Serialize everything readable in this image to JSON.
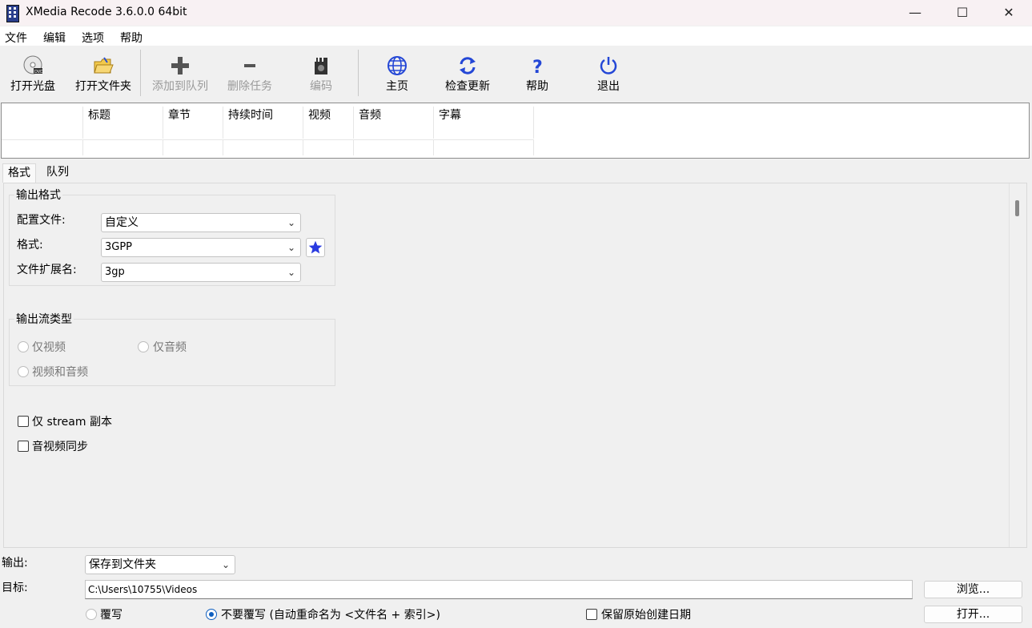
{
  "window": {
    "title": "XMedia Recode 3.6.0.0 64bit",
    "min": "—",
    "max": "☐",
    "close": "✕"
  },
  "menu": [
    "文件",
    "编辑",
    "选项",
    "帮助"
  ],
  "toolbar": {
    "open_disc": "打开光盘",
    "open_folder": "打开文件夹",
    "add_queue": "添加到队列",
    "delete_task": "删除任务",
    "encode": "编码",
    "home": "主页",
    "check_update": "检查更新",
    "help": "帮助",
    "exit": "退出"
  },
  "list": {
    "columns": [
      "标题",
      "章节",
      "持续时间",
      "视频",
      "音频",
      "字幕"
    ]
  },
  "tabs": [
    "格式",
    "队列"
  ],
  "output_format": {
    "group": "输出格式",
    "profile_label": "配置文件:",
    "profile_value": "自定义",
    "format_label": "格式:",
    "format_value": "3GPP",
    "ext_label": "文件扩展名:",
    "ext_value": "3gp"
  },
  "stream_type": {
    "group": "输出流类型",
    "video_only": "仅视频",
    "audio_only": "仅音频",
    "video_audio": "视频和音频"
  },
  "options": {
    "stream_copy": "仅 stream 副本",
    "av_sync": "音视频同步"
  },
  "bottom": {
    "output_label": "输出:",
    "output_value": "保存到文件夹",
    "target_label": "目标:",
    "target_value": "C:\\Users\\10755\\Videos",
    "browse": "浏览...",
    "open": "打开...",
    "overwrite": "覆写",
    "no_overwrite": "不要覆写 (自动重命名为 <文件名 + 索引>)",
    "keep_date": "保留原始创建日期"
  },
  "colors": {
    "accent": "#0f5fbf",
    "icon_blue": "#2447d6",
    "star": "#2a3be0"
  }
}
